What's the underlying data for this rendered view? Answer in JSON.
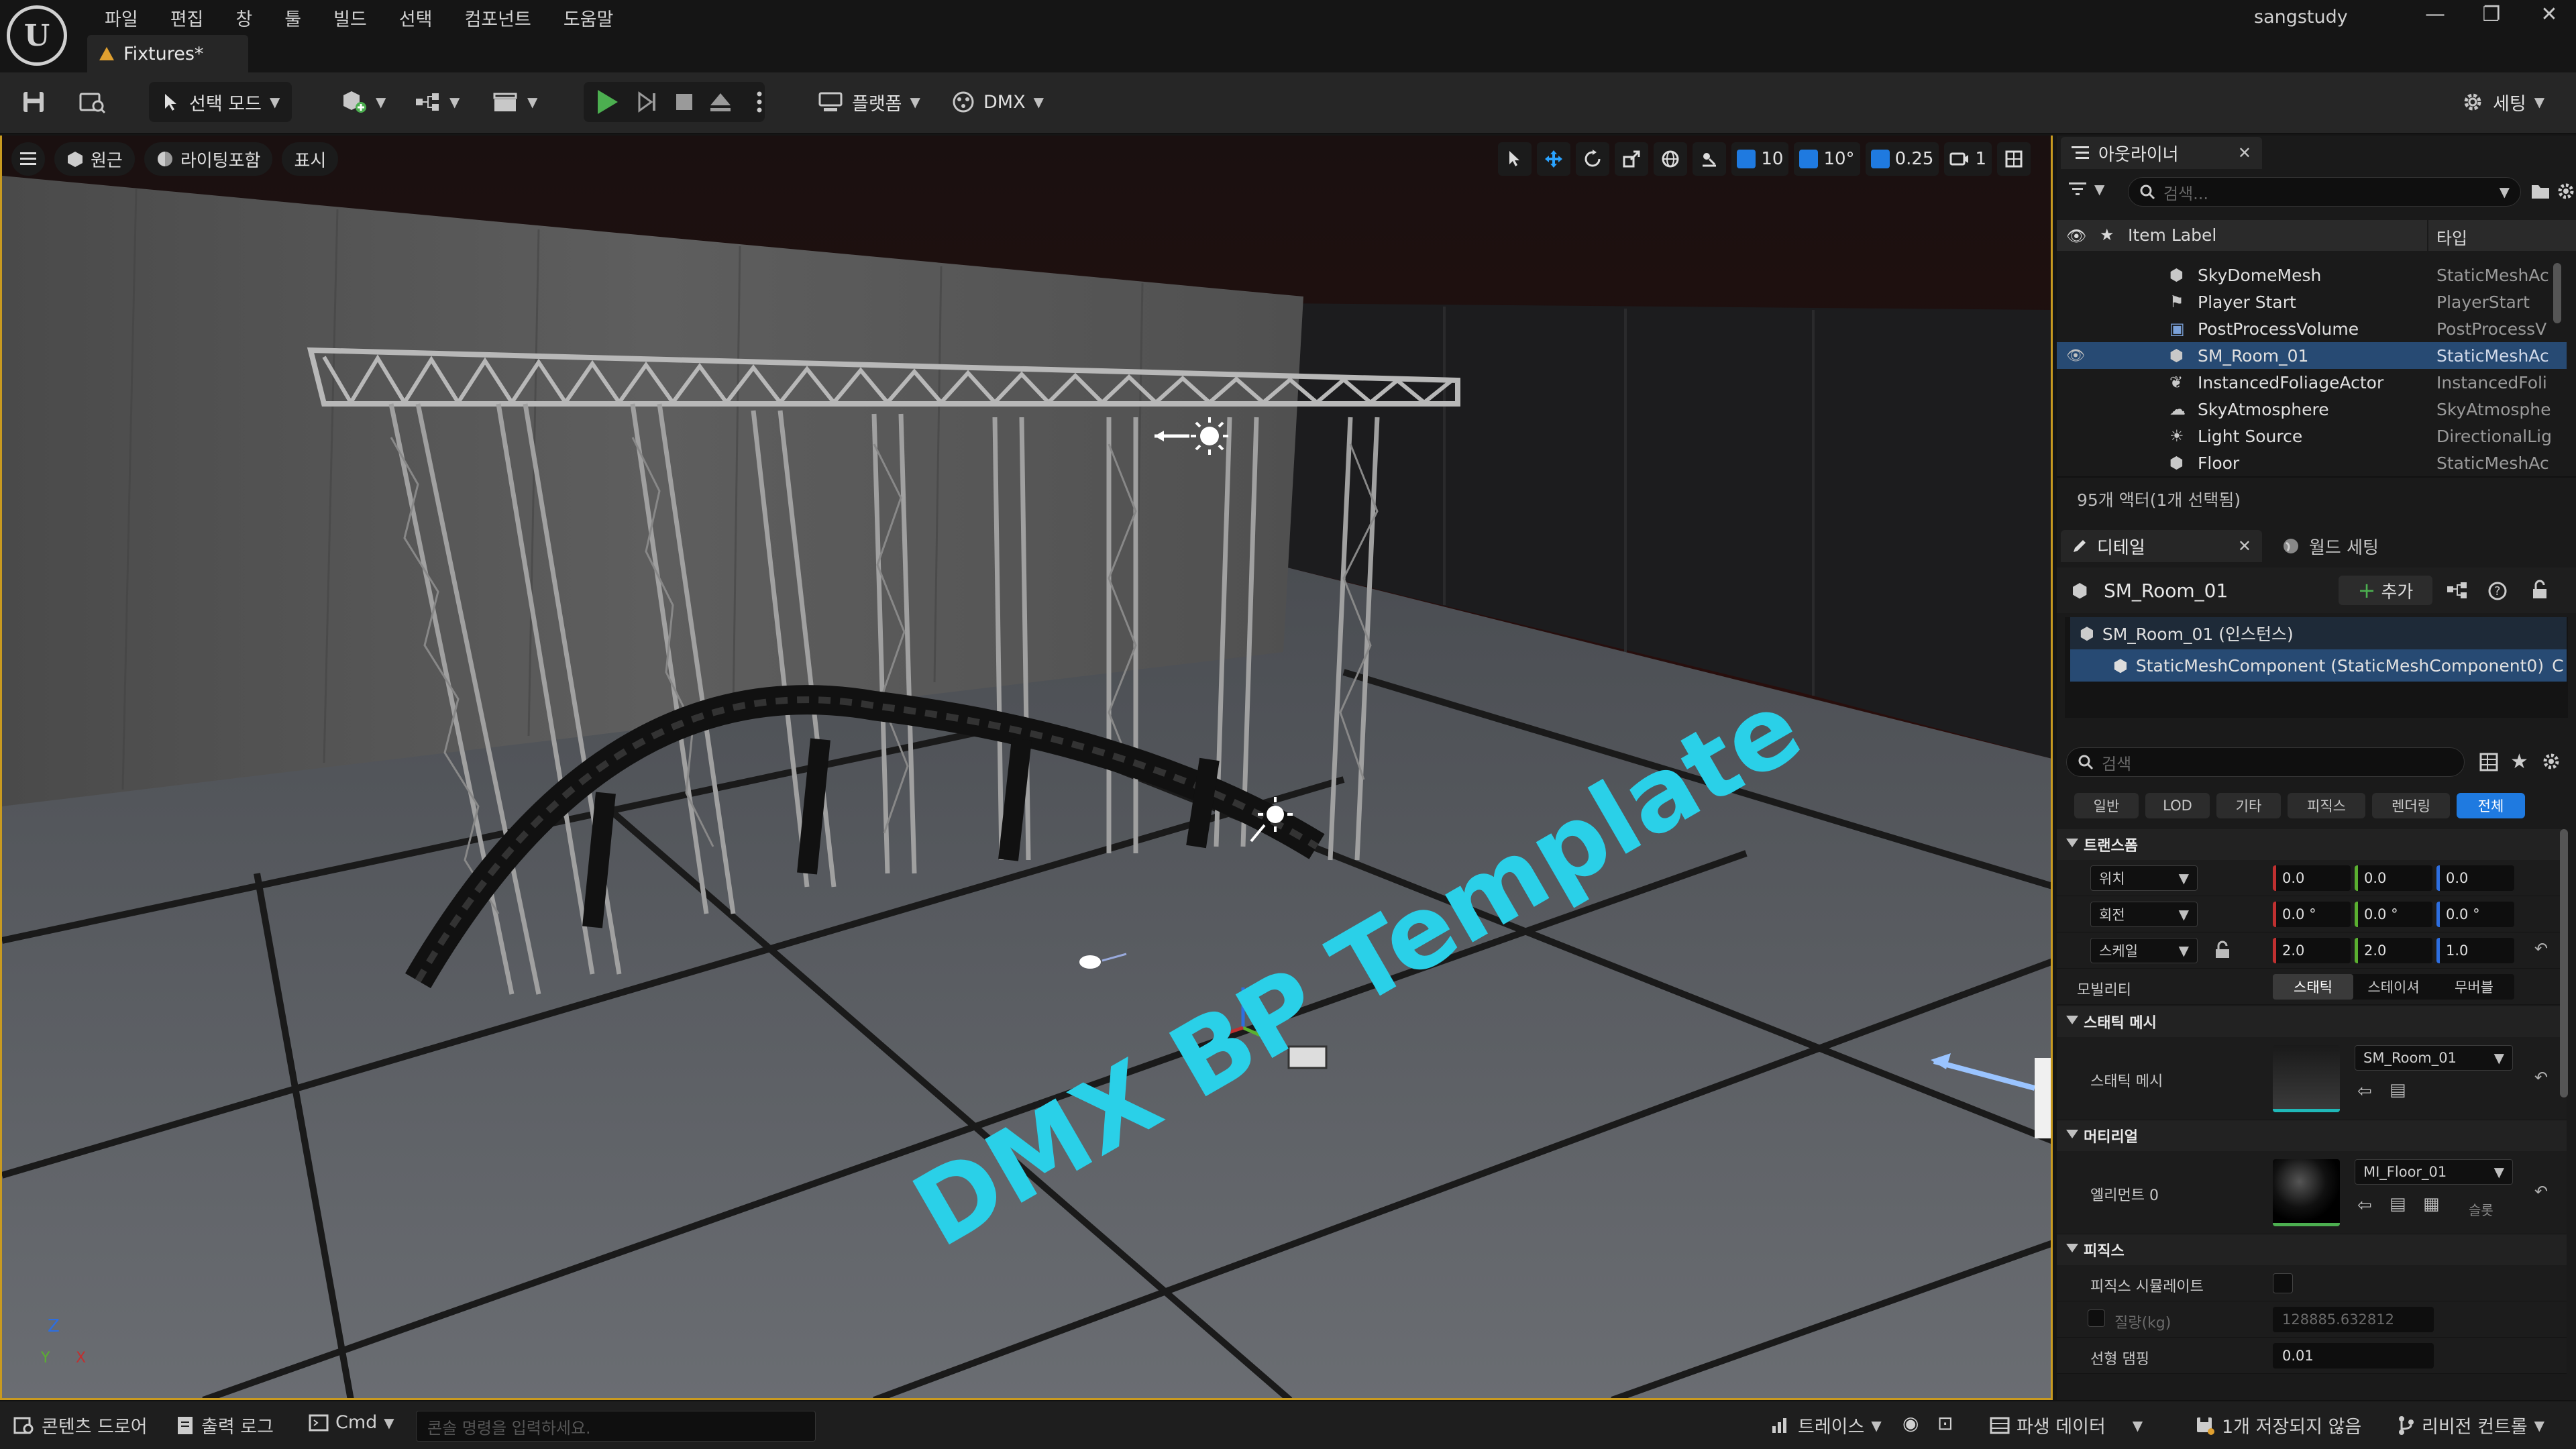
{
  "titlebar": {
    "menu": [
      "파일",
      "편집",
      "창",
      "툴",
      "빌드",
      "선택",
      "컴포넌트",
      "도움말"
    ],
    "document_tab": "Fixtures*",
    "user": "sangstudy",
    "controls": [
      "—",
      "❐",
      "✕"
    ]
  },
  "toolbar": {
    "mode": "선택 모드",
    "platform": "플랫폼",
    "dmx": "DMX",
    "settings": "세팅"
  },
  "viewport": {
    "view_mode": "원근",
    "lighting": "라이팅포함",
    "show": "표시",
    "grid_snap": "10",
    "rotate_snap": "10°",
    "scale_snap": "0.25",
    "camera_speed": "1",
    "floor_text": "DMX BP Template",
    "axis_labels": [
      "Z",
      "Y",
      "X"
    ],
    "accent_text_color": "#2ad0e8"
  },
  "outliner": {
    "tab": "아웃라이너",
    "search_placeholder": "검색...",
    "col_label": "Item Label",
    "col_type": "타입",
    "rows": [
      {
        "label": "SkyDomeMesh",
        "type": "StaticMeshAc"
      },
      {
        "label": "Player Start",
        "type": "PlayerStart"
      },
      {
        "label": "PostProcessVolume",
        "type": "PostProcessV"
      },
      {
        "label": "SM_Room_01",
        "type": "StaticMeshAc"
      },
      {
        "label": "InstancedFoliageActor",
        "type": "InstancedFoli"
      },
      {
        "label": "SkyAtmosphere",
        "type": "SkyAtmosphe"
      },
      {
        "label": "Light Source",
        "type": "DirectionalLig"
      },
      {
        "label": "Floor",
        "type": "StaticMeshAc"
      }
    ],
    "count": "95개 액터(1개 선택됨)"
  },
  "details": {
    "tab": "디테일",
    "tab2": "월드 세팅",
    "actor": "SM_Room_01",
    "add": "추가",
    "instance": "SM_Room_01 (인스턴스)",
    "component": "StaticMeshComponent (StaticMeshComponent0)",
    "component_suffix": "C",
    "search_placeholder": "검색",
    "filters": [
      "일반",
      "LOD",
      "기타",
      "피직스",
      "렌더링",
      "전체"
    ],
    "transform": {
      "title": "트랜스폼",
      "location_label": "위치",
      "rotation_label": "회전",
      "scale_label": "스케일",
      "location": [
        "0.0",
        "0.0",
        "0.0"
      ],
      "rotation": [
        "0.0 °",
        "0.0 °",
        "0.0 °"
      ],
      "scale": [
        "2.0",
        "2.0",
        "1.0"
      ],
      "mobility_label": "모빌리티",
      "mobility": [
        "스태틱",
        "스테이셔",
        "무버블"
      ]
    },
    "static_mesh": {
      "title": "스태틱 메시",
      "label": "스태틱 메시",
      "value": "SM_Room_01"
    },
    "materials": {
      "title": "머티리얼",
      "label": "엘리먼트 0",
      "value": "MI_Floor_01",
      "slot": "슬롯"
    },
    "physics": {
      "title": "피직스",
      "simulate_label": "피직스 시뮬레이트",
      "mass_label": "질량(kg)",
      "mass_value": "128885.632812",
      "damping_label": "선형 댐핑",
      "damping_value": "0.01"
    }
  },
  "statusbar": {
    "content_drawer": "콘텐츠 드로어",
    "output_log": "출력 로그",
    "cmd": "Cmd",
    "cmd_placeholder": "콘솔 명령을 입력하세요.",
    "trace": "트레이스",
    "derived": "파생 데이터",
    "unsaved": "1개 저장되지 않음",
    "revision": "리비전 컨트롤"
  }
}
